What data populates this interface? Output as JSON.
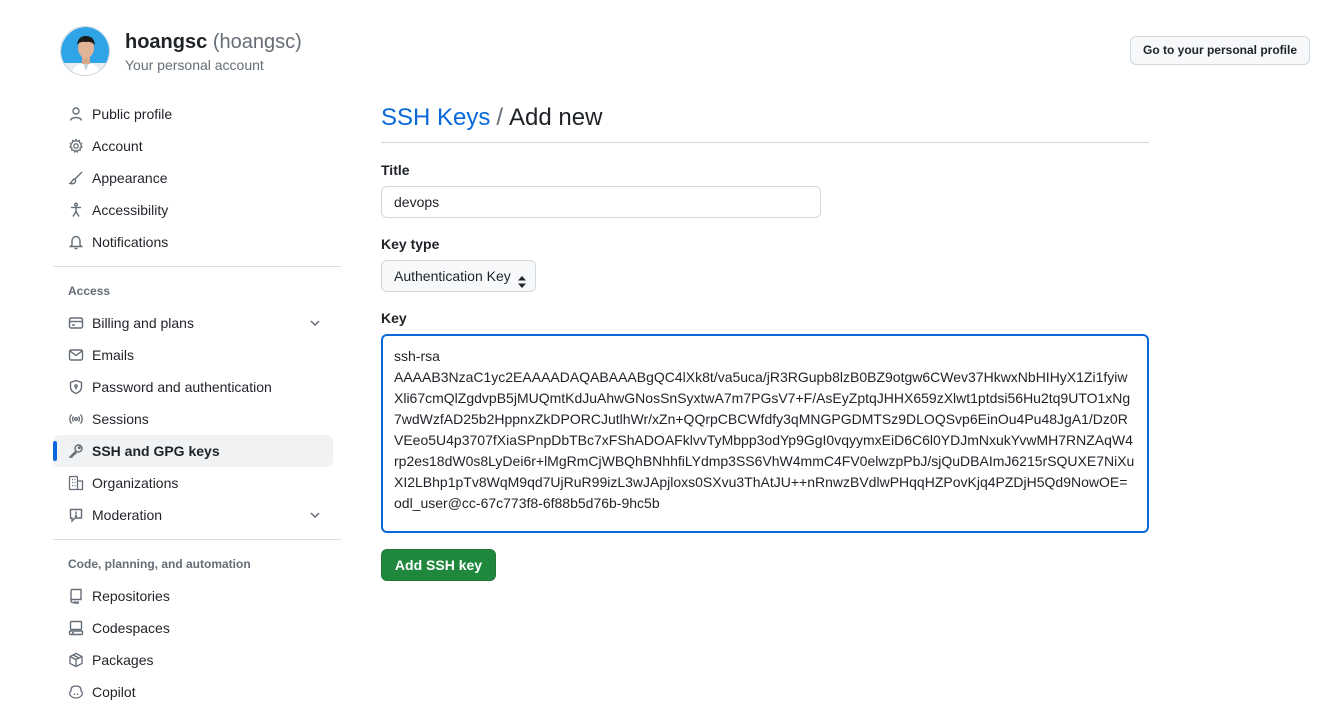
{
  "header": {
    "name": "hoangsc",
    "login": "(hoangsc)",
    "subtitle": "Your personal account",
    "profile_button": "Go to your personal profile"
  },
  "sidebar": {
    "top_items": [
      {
        "label": "Public profile",
        "icon": "person-icon"
      },
      {
        "label": "Account",
        "icon": "gear-icon"
      },
      {
        "label": "Appearance",
        "icon": "paintbrush-icon"
      },
      {
        "label": "Accessibility",
        "icon": "accessibility-icon"
      },
      {
        "label": "Notifications",
        "icon": "bell-icon"
      }
    ],
    "access_title": "Access",
    "access_items": [
      {
        "label": "Billing and plans",
        "icon": "credit-card-icon",
        "expandable": true
      },
      {
        "label": "Emails",
        "icon": "mail-icon"
      },
      {
        "label": "Password and authentication",
        "icon": "shield-lock-icon"
      },
      {
        "label": "Sessions",
        "icon": "broadcast-icon"
      },
      {
        "label": "SSH and GPG keys",
        "icon": "key-icon",
        "active": true
      },
      {
        "label": "Organizations",
        "icon": "organization-icon"
      },
      {
        "label": "Moderation",
        "icon": "report-icon",
        "expandable": true
      }
    ],
    "code_title": "Code, planning, and automation",
    "code_items": [
      {
        "label": "Repositories",
        "icon": "repo-icon"
      },
      {
        "label": "Codespaces",
        "icon": "codespaces-icon"
      },
      {
        "label": "Packages",
        "icon": "package-icon"
      },
      {
        "label": "Copilot",
        "icon": "copilot-icon"
      }
    ]
  },
  "main": {
    "breadcrumb_link": "SSH Keys",
    "breadcrumb_sep": "/",
    "breadcrumb_current": "Add new",
    "title_label": "Title",
    "title_value": "devops",
    "key_type_label": "Key type",
    "key_type_value": "Authentication Key",
    "key_label": "Key",
    "key_value": "ssh-rsa\nAAAAB3NzaC1yc2EAAAADAQABAAABgQC4lXk8t/va5uca/jR3RGupb8lzB0BZ9otgw6CWev37HkwxNbHIHyX1Zi1fyiwXli67cmQlZgdvpB5jMUQmtKdJuAhwGNosSnSyxtwA7m7PGsV7+F/AsEyZptqJHHX659zXlwt1ptdsi56Hu2tq9UTO1xNg7wdWzfAD25b2HppnxZkDPORCJutlhWr/xZn+QQrpCBCWfdfy3qMNGPGDMTSz9DLOQSvp6EinOu4Pu48JgA1/Dz0RVEeo5U4p3707fXiaSPnpDbTBc7xFShADOAFklvvTyMbpp3odYp9GgI0vqyymxEiD6C6l0YDJmNxukYvwMH7RNZAqW4rp2es18dW0s8LyDei6r+lMgRmCjWBQhBNhhfiLYdmp3SS6VhW4mmC4FV0elwzpPbJ/sjQuDBAImJ6215rSQUXE7NiXuXI2LBhp1pTv8WqM9qd7UjRuR99izL3wJApjloxs0SXvu3ThAtJU++nRnwzBVdlwPHqqHZPovKjq4PZDjH5Qd9NowOE= odl_user@cc-67c773f8-6f88b5d76b-9hc5b",
    "add_button": "Add SSH key"
  },
  "colors": {
    "accent": "#0969da",
    "primary_button": "#1f883d"
  }
}
